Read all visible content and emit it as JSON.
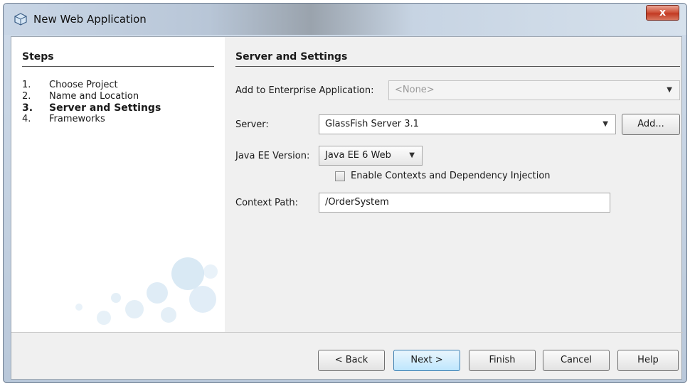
{
  "window": {
    "title": "New Web Application",
    "close_symbol": "x"
  },
  "steps": {
    "heading": "Steps",
    "items": [
      {
        "num": "1.",
        "label": "Choose Project",
        "current": false
      },
      {
        "num": "2.",
        "label": "Name and Location",
        "current": false
      },
      {
        "num": "3.",
        "label": "Server and Settings",
        "current": true
      },
      {
        "num": "4.",
        "label": "Frameworks",
        "current": false
      }
    ]
  },
  "form": {
    "heading": "Server and Settings",
    "enterprise_label": "Add to Enterprise Application:",
    "enterprise_value": "<None>",
    "server_label": "Server:",
    "server_value": "GlassFish Server 3.1",
    "add_button": "Add...",
    "javaee_label": "Java EE Version:",
    "javaee_value": "Java EE 6 Web",
    "cdi_label": "Enable Contexts and Dependency Injection",
    "cdi_checked": false,
    "context_label": "Context Path:",
    "context_value": "/OrderSystem"
  },
  "buttons": {
    "back": "< Back",
    "next": "Next >",
    "finish": "Finish",
    "cancel": "Cancel",
    "help": "Help"
  },
  "icons": {
    "app": "netbeans-cube-icon",
    "dropdown": "chevron-down-icon"
  }
}
